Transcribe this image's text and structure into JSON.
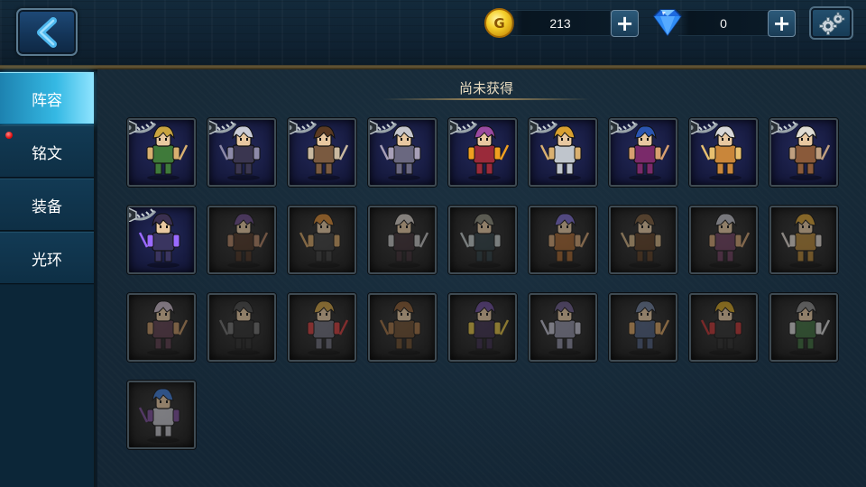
{
  "currency": {
    "gold": {
      "icon": "gold-coin-icon",
      "glyph": "G",
      "value": "213"
    },
    "gems": {
      "icon": "blue-diamond-icon",
      "value": "0"
    },
    "add_glyph": "+"
  },
  "sidebar": {
    "items": [
      {
        "label": "阵容",
        "active": true,
        "notification": false
      },
      {
        "label": "铭文",
        "active": false,
        "notification": true
      },
      {
        "label": "装备",
        "active": false,
        "notification": false
      },
      {
        "label": "光环",
        "active": false,
        "notification": false
      }
    ]
  },
  "main": {
    "section_title": "尚未获得"
  },
  "heroes": [
    {
      "state": "owned",
      "hair": "#c9a440",
      "body": "#3f7a3a",
      "accent": "#d8b070"
    },
    {
      "state": "owned",
      "hair": "#c9cbd6",
      "body": "#3a3650",
      "accent": "#8d8aa8"
    },
    {
      "state": "owned",
      "hair": "#5a3a22",
      "body": "#7a5a40",
      "accent": "#c9b9a0"
    },
    {
      "state": "owned",
      "hair": "#c6c6cc",
      "body": "#6a6880",
      "accent": "#a8a0b8"
    },
    {
      "state": "owned",
      "hair": "#9a4aa0",
      "body": "#9a2a3a",
      "accent": "#f0a020"
    },
    {
      "state": "owned",
      "hair": "#d9a030",
      "body": "#bfc5cc",
      "accent": "#d9b070"
    },
    {
      "state": "owned",
      "hair": "#2a55b0",
      "body": "#7a2a6a",
      "accent": "#d7a070"
    },
    {
      "state": "owned",
      "hair": "#d8d8d8",
      "body": "#c9863a",
      "accent": "#e8c070"
    },
    {
      "state": "owned",
      "hair": "#e0ddd4",
      "body": "#8a5a3a",
      "accent": "#c0a080"
    },
    {
      "state": "owned",
      "hair": "#3a3050",
      "body": "#3a3560",
      "accent": "#9a6aff"
    },
    {
      "state": "locked",
      "hair": "#6a4a8a",
      "body": "#4a3020",
      "accent": "#b08060"
    },
    {
      "state": "locked",
      "hair": "#d88830",
      "body": "#3a3a3a",
      "accent": "#d0a060"
    },
    {
      "state": "locked",
      "hair": "#d8d0c8",
      "body": "#3a2a30",
      "accent": "#c0c0c0"
    },
    {
      "state": "locked",
      "hair": "#8a8a7a",
      "body": "#2a3a40",
      "accent": "#c0c8c8"
    },
    {
      "state": "locked",
      "hair": "#7a6ad0",
      "body": "#a0602a",
      "accent": "#d0a070"
    },
    {
      "state": "locked",
      "hair": "#7a5a3a",
      "body": "#5a3a20",
      "accent": "#d0b080"
    },
    {
      "state": "locked",
      "hair": "#c0c0c8",
      "body": "#6a3a5a",
      "accent": "#d0a070"
    },
    {
      "state": "locked",
      "hair": "#d9a030",
      "body": "#b08030",
      "accent": "#e0d8d0"
    },
    {
      "state": "locked",
      "hair": "#c8b8c8",
      "body": "#5a3a4a",
      "accent": "#c09060"
    },
    {
      "state": "locked",
      "hair": "#4a4a4a",
      "body": "#2a2a2a",
      "accent": "#707070"
    },
    {
      "state": "locked",
      "hair": "#d0a040",
      "body": "#6a6a78",
      "accent": "#d03a3a"
    },
    {
      "state": "locked",
      "hair": "#8a5a30",
      "body": "#6a4a2a",
      "accent": "#a07040"
    },
    {
      "state": "locked",
      "hair": "#6a4a9a",
      "body": "#3a2a4a",
      "accent": "#e0c040"
    },
    {
      "state": "locked",
      "hair": "#6a5a8a",
      "body": "#8a8aa0",
      "accent": "#c0c0d0"
    },
    {
      "state": "locked",
      "hair": "#6a7a9a",
      "body": "#4a5a7a",
      "accent": "#d8a060"
    },
    {
      "state": "locked",
      "hair": "#d0a020",
      "body": "#2a2a2a",
      "accent": "#c03030"
    },
    {
      "state": "locked",
      "hair": "#8a8a8a",
      "body": "#3a6a3a",
      "accent": "#d8d8d8"
    },
    {
      "state": "locked",
      "hair": "#3a7ad8",
      "body": "#c0c0c8",
      "accent": "#7a4a9a"
    }
  ]
}
